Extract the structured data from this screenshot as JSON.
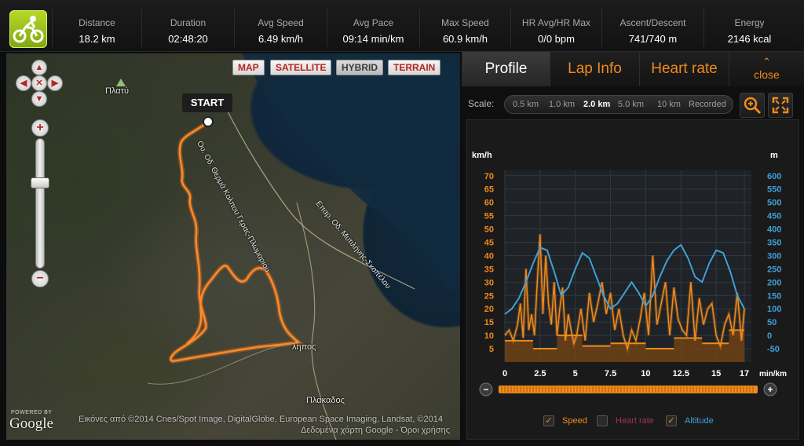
{
  "stats": [
    {
      "label": "Distance",
      "value": "18.2 km"
    },
    {
      "label": "Duration",
      "value": "02:48:20"
    },
    {
      "label": "Avg Speed",
      "value": "6.49 km/h"
    },
    {
      "label": "Avg Pace",
      "value": "09:14 min/km"
    },
    {
      "label": "Max Speed",
      "value": "60.9 km/h"
    },
    {
      "label": "HR Avg/HR Max",
      "value": "0/0 bpm"
    },
    {
      "label": "Ascent/Descent",
      "value": "741/740 m"
    },
    {
      "label": "Energy",
      "value": "2146 kcal"
    }
  ],
  "map": {
    "types": [
      "MAP",
      "SATELLITE",
      "HYBRID",
      "TERRAIN"
    ],
    "active_type": "HYBRID",
    "start_label": "START",
    "place_labels": [
      "Πλατύ",
      "Πλακαδος",
      "ληπος"
    ],
    "road_labels": [
      "Ου. Οδ. Θερμά Κολπου Γερας-Πλωμαριου",
      "Επαρ. Οδ. Μυτιλήνης-Σκοπέλου"
    ],
    "powered_by": "POWERED BY",
    "google": "Google",
    "attribution": "Εικόνες από ©2014 Cnes/Spot Image, DigitalGlobe, European Space Imaging, Landsat, ©2014",
    "attribution2": "Δεδομένα χάρτη Google - Όροι χρήσης"
  },
  "tabs": [
    {
      "label": "Profile",
      "active": true
    },
    {
      "label": "Lap Info",
      "active": false
    },
    {
      "label": "Heart rate",
      "active": false
    }
  ],
  "close_label": "close",
  "scale": {
    "label": "Scale:",
    "options": [
      "0.5 km",
      "1.0 km",
      "2.0 km",
      "5.0 km",
      "10 km",
      "Recorded"
    ],
    "selected": "2.0 km"
  },
  "checkboxes": [
    {
      "label": "Speed",
      "checked": true,
      "color": "#f08a1c"
    },
    {
      "label": "Heart rate",
      "checked": false,
      "color": "#a0325c"
    },
    {
      "label": "Altitude",
      "checked": true,
      "color": "#3ea0d8"
    }
  ],
  "chart_data": {
    "type": "line",
    "ylabel_left": "km/h",
    "ylabel_right": "m",
    "xlabel": "min/km",
    "x_ticks": [
      "0",
      "2.5",
      "5",
      "7.5",
      "10",
      "12.5",
      "15",
      "17"
    ],
    "y_left_ticks": [
      5,
      10,
      15,
      20,
      25,
      30,
      35,
      40,
      45,
      50,
      55,
      60,
      65,
      70
    ],
    "y_right_ticks": [
      -50,
      0,
      50,
      100,
      150,
      200,
      250,
      300,
      350,
      400,
      450,
      500,
      550,
      600
    ],
    "ylim_left": [
      0,
      72
    ],
    "ylim_right": [
      -100,
      620
    ],
    "xlim": [
      0,
      17.5
    ],
    "series": [
      {
        "name": "Speed",
        "color": "#f08a1c",
        "x": [
          0,
          0.3,
          0.6,
          0.9,
          1.1,
          1.3,
          1.5,
          1.7,
          1.9,
          2.1,
          2.3,
          2.5,
          2.7,
          2.9,
          3.1,
          3.3,
          3.5,
          3.7,
          3.9,
          4.1,
          4.3,
          4.5,
          4.7,
          4.9,
          5.1,
          5.4,
          5.7,
          6.0,
          6.3,
          6.6,
          6.9,
          7.2,
          7.5,
          7.8,
          8.1,
          8.4,
          8.7,
          9.0,
          9.3,
          9.6,
          9.9,
          10.2,
          10.5,
          10.8,
          11.1,
          11.4,
          11.7,
          12.0,
          12.3,
          12.6,
          12.9,
          13.2,
          13.5,
          13.8,
          14.1,
          14.4,
          14.7,
          15.0,
          15.3,
          15.6,
          15.9,
          16.2,
          16.5,
          16.8,
          17.0
        ],
        "values": [
          10,
          12,
          8,
          14,
          22,
          9,
          35,
          12,
          18,
          10,
          30,
          48,
          18,
          40,
          22,
          14,
          30,
          10,
          20,
          28,
          8,
          18,
          12,
          7,
          10,
          20,
          8,
          26,
          15,
          22,
          30,
          18,
          26,
          12,
          20,
          10,
          5,
          12,
          8,
          16,
          26,
          10,
          40,
          14,
          22,
          30,
          10,
          28,
          16,
          12,
          10,
          30,
          8,
          24,
          14,
          20,
          22,
          10,
          6,
          14,
          18,
          10,
          26,
          8,
          20
        ]
      },
      {
        "name": "Altitude",
        "color": "#3ea0d8",
        "x": [
          0,
          0.5,
          1.0,
          1.5,
          2.0,
          2.5,
          3.0,
          3.5,
          4.0,
          4.5,
          5.0,
          5.5,
          6.0,
          6.5,
          7.0,
          7.5,
          8.0,
          8.5,
          9.0,
          9.5,
          10.0,
          10.5,
          11.0,
          11.5,
          12.0,
          12.5,
          13.0,
          13.5,
          14.0,
          14.5,
          15.0,
          15.5,
          16.0,
          16.5,
          17.0
        ],
        "values": [
          80,
          100,
          140,
          200,
          270,
          330,
          320,
          240,
          150,
          180,
          250,
          310,
          290,
          220,
          150,
          100,
          120,
          160,
          200,
          160,
          110,
          150,
          220,
          280,
          320,
          340,
          290,
          220,
          200,
          270,
          320,
          310,
          240,
          150,
          100
        ]
      }
    ],
    "lap_bars": [
      {
        "x0": 0,
        "x1": 2.0,
        "value": 8
      },
      {
        "x0": 2.0,
        "x1": 3.7,
        "value": 5
      },
      {
        "x0": 3.7,
        "x1": 5.5,
        "value": 10
      },
      {
        "x0": 5.5,
        "x1": 7.5,
        "value": 6
      },
      {
        "x0": 7.5,
        "x1": 10.0,
        "value": 7
      },
      {
        "x0": 10.0,
        "x1": 12.0,
        "value": 5
      },
      {
        "x0": 12.0,
        "x1": 14.0,
        "value": 9
      },
      {
        "x0": 14.0,
        "x1": 15.9,
        "value": 7
      },
      {
        "x0": 15.9,
        "x1": 17.0,
        "value": 12
      }
    ]
  }
}
